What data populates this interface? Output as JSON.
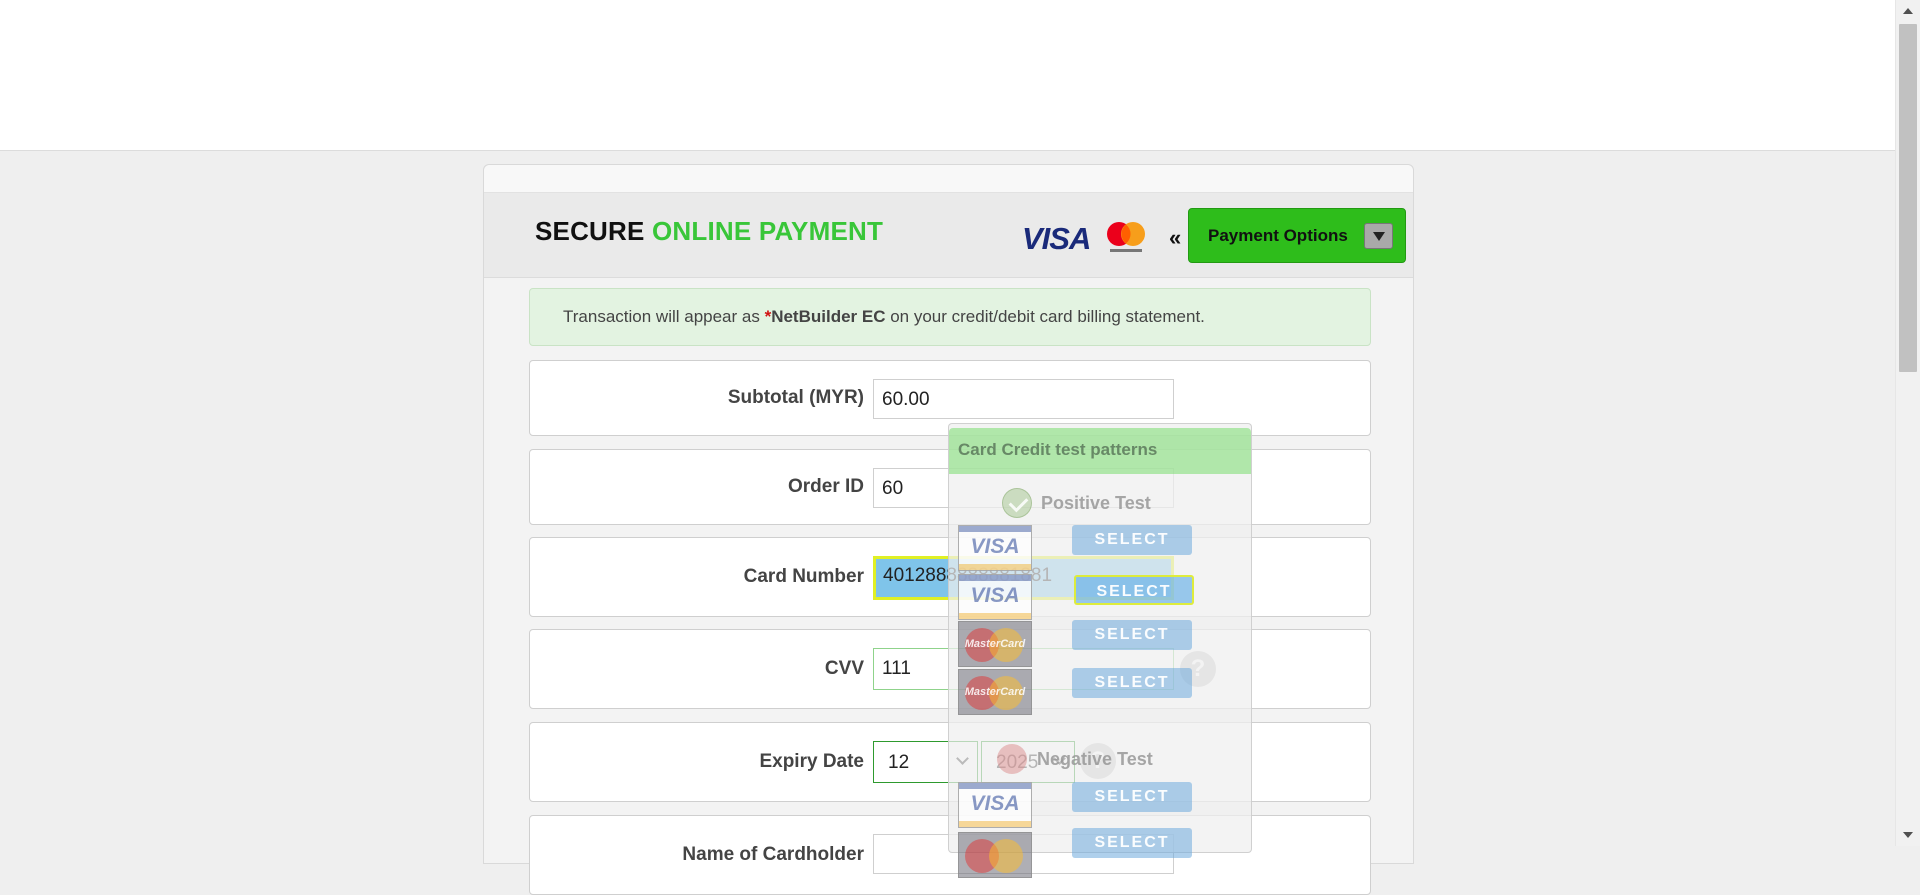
{
  "header": {
    "title_word1": "SECURE",
    "title_word2": "ONLINE PAYMENT",
    "visa_label": "VISA",
    "mastercard_label": "mastercard",
    "guillemet": "«",
    "payment_options_label": "Payment Options"
  },
  "notice": {
    "prefix": "Transaction will appear as ",
    "star": "*",
    "merchant": "NetBuilder EC",
    "suffix": " on your credit/debit card billing statement."
  },
  "form": {
    "subtotal_label": "Subtotal (MYR)",
    "subtotal_value": "60.00",
    "order_id_label": "Order ID",
    "order_id_value": "60",
    "card_number_label": "Card Number",
    "card_number_value": "4012888888881881",
    "cvv_label": "CVV",
    "cvv_value": "111",
    "expiry_label": "Expiry Date",
    "expiry_month": "12",
    "expiry_year": "2025",
    "name_label": "Name of Cardholder"
  },
  "test_patterns": {
    "title": "Card Credit test patterns",
    "positive_label": "Positive Test",
    "negative_label": "Negative Test",
    "select_label": "SELECT",
    "visa_label": "VISA",
    "mastercard_label": "MasterCard",
    "help_glyph": "?"
  },
  "colors": {
    "accent_green": "#39c639",
    "button_green": "#2ebd1b",
    "highlight_blue": "#7fc4ea",
    "highlight_yellow": "#e0f025"
  }
}
